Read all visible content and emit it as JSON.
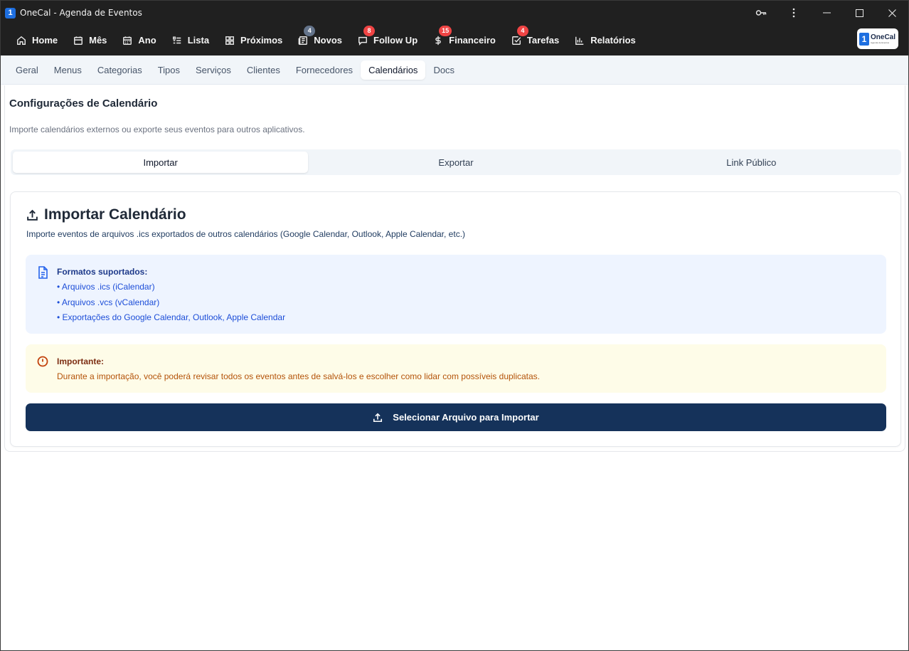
{
  "window": {
    "title": "OneCal - Agenda de Eventos",
    "logo_char": "1"
  },
  "nav": {
    "items": [
      {
        "label": "Home",
        "icon": "home-icon"
      },
      {
        "label": "Mês",
        "icon": "calendar-icon"
      },
      {
        "label": "Ano",
        "icon": "calendar-grid-icon"
      },
      {
        "label": "Lista",
        "icon": "list-icon"
      },
      {
        "label": "Próximos",
        "icon": "layout-icon"
      },
      {
        "label": "Novos",
        "icon": "newspaper-icon",
        "badge": "4",
        "badge_color": "#64748b"
      },
      {
        "label": "Follow Up",
        "icon": "message-icon",
        "badge": "8",
        "badge_color": "#ef4444"
      },
      {
        "label": "Financeiro",
        "icon": "dollar-icon",
        "badge": "15",
        "badge_color": "#ef4444"
      },
      {
        "label": "Tarefas",
        "icon": "checkbox-icon",
        "badge": "4",
        "badge_color": "#ef4444"
      },
      {
        "label": "Relatórios",
        "icon": "bar-chart-icon"
      }
    ],
    "brand": {
      "mark": "1",
      "name": "OneCal",
      "sub": "Agenda de Eventos"
    }
  },
  "settings_tabs": [
    "Geral",
    "Menus",
    "Categorias",
    "Tipos",
    "Serviços",
    "Clientes",
    "Fornecedores",
    "Calendários",
    "Docs"
  ],
  "settings_active": "Calendários",
  "page": {
    "title": "Configurações de Calendário",
    "description": "Importe calendários externos ou exporte seus eventos para outros aplicativos."
  },
  "segments": [
    "Importar",
    "Exportar",
    "Link Público"
  ],
  "segment_active": "Importar",
  "import": {
    "title": "Importar Calendário",
    "description": "Importe eventos de arquivos .ics exportados de outros calendários (Google Calendar, Outlook, Apple Calendar, etc.)",
    "formats_title": "Formatos suportados:",
    "formats": [
      "• Arquivos .ics (iCalendar)",
      "• Arquivos .vcs (vCalendar)",
      "• Exportações do Google Calendar, Outlook, Apple Calendar"
    ],
    "warning_title": "Importante:",
    "warning_text": "Durante a importação, você poderá revisar todos os eventos antes de salvá-los e escolher como lidar com possíveis duplicatas.",
    "button_label": "Selecionar Arquivo para Importar"
  },
  "colors": {
    "titlebar": "#202020",
    "primary_button": "#15325a",
    "info_bg": "#eef4ff",
    "warning_bg": "#fefce8"
  }
}
